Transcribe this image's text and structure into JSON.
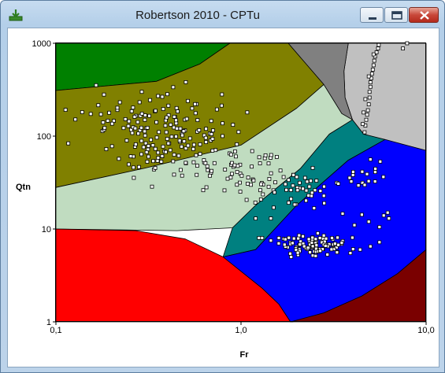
{
  "window": {
    "title": "Robertson 2010 - CPTu",
    "app_icon": "download-icon",
    "controls": {
      "minimize": "minimize-icon",
      "maximize": "maximize-icon",
      "close": "close-icon"
    }
  },
  "chart_data": {
    "type": "scatter",
    "title": "",
    "xlabel": "Fr",
    "ylabel": "Qtn",
    "xscale": "log",
    "yscale": "log",
    "xlim": [
      0.1,
      10
    ],
    "ylim": [
      1,
      1000
    ],
    "xticks": [
      {
        "value": 0.1,
        "label": "0,1"
      },
      {
        "value": 1,
        "label": "1,0"
      },
      {
        "value": 10,
        "label": "10,0"
      }
    ],
    "yticks": [
      {
        "value": 1,
        "label": "1"
      },
      {
        "value": 10,
        "label": "10"
      },
      {
        "value": 100,
        "label": "100"
      },
      {
        "value": 1000,
        "label": "1000"
      }
    ],
    "grid": false,
    "zone_colors": {
      "zone1": "#ff0000",
      "zone2": "#7a0000",
      "zone3": "#0000ff",
      "zone4": "#008080",
      "zone5": "#c0dcc0",
      "zone6": "#808000",
      "zone7": "#008000",
      "zone8": "#808080",
      "zone9": "#c0c0c0",
      "background": "#ffffff"
    },
    "zones": [
      {
        "id": "zone9",
        "points": [
          [
            3.8,
            1000
          ],
          [
            3.6,
            500
          ],
          [
            3.65,
            260
          ],
          [
            4.0,
            150
          ],
          [
            4.6,
            105
          ],
          [
            10,
            70
          ],
          [
            10,
            1000
          ]
        ]
      },
      {
        "id": "zone8",
        "points": [
          [
            1.8,
            1000
          ],
          [
            2.8,
            360
          ],
          [
            3.5,
            175
          ],
          [
            4.0,
            150
          ],
          [
            3.65,
            260
          ],
          [
            3.6,
            500
          ],
          [
            3.8,
            1000
          ]
        ]
      },
      {
        "id": "zone7",
        "points": [
          [
            0.1,
            1000
          ],
          [
            0.87,
            1000
          ],
          [
            0.6,
            600
          ],
          [
            0.35,
            390
          ],
          [
            0.1,
            310
          ]
        ]
      },
      {
        "id": "zone6",
        "points": [
          [
            0.1,
            310
          ],
          [
            0.35,
            390
          ],
          [
            0.6,
            600
          ],
          [
            0.87,
            1000
          ],
          [
            1.8,
            1000
          ],
          [
            2.8,
            360
          ],
          [
            2.0,
            200
          ],
          [
            1.0,
            80
          ],
          [
            0.3,
            45
          ],
          [
            0.1,
            28
          ]
        ]
      },
      {
        "id": "zone5",
        "points": [
          [
            0.1,
            28
          ],
          [
            0.3,
            45
          ],
          [
            1.0,
            80
          ],
          [
            2.0,
            200
          ],
          [
            2.8,
            360
          ],
          [
            3.5,
            175
          ],
          [
            4.0,
            150
          ],
          [
            3.0,
            105
          ],
          [
            2.1,
            45
          ],
          [
            1.2,
            18
          ],
          [
            0.9,
            10.3
          ],
          [
            0.45,
            9.6
          ],
          [
            0.1,
            10
          ]
        ]
      },
      {
        "id": "zone4",
        "points": [
          [
            0.9,
            10.3
          ],
          [
            1.2,
            18
          ],
          [
            2.1,
            45
          ],
          [
            3.0,
            105
          ],
          [
            4.0,
            150
          ],
          [
            4.6,
            105
          ],
          [
            6.0,
            92
          ],
          [
            3.8,
            55
          ],
          [
            2.0,
            18
          ],
          [
            1.2,
            6
          ],
          [
            0.8,
            5
          ]
        ]
      },
      {
        "id": "zone3",
        "points": [
          [
            0.8,
            5
          ],
          [
            1.2,
            6
          ],
          [
            2.0,
            18
          ],
          [
            3.8,
            55
          ],
          [
            6.0,
            92
          ],
          [
            10,
            70
          ],
          [
            10,
            6
          ],
          [
            7.0,
            3.3
          ],
          [
            4.5,
            1.9
          ],
          [
            2.8,
            1.25
          ],
          [
            1.9,
            1
          ],
          [
            1.85,
            1
          ],
          [
            1.6,
            1.55
          ],
          [
            1.3,
            2.3
          ],
          [
            1.0,
            3.5
          ]
        ]
      },
      {
        "id": "zone2",
        "points": [
          [
            1.85,
            1
          ],
          [
            2.8,
            1.25
          ],
          [
            4.5,
            1.9
          ],
          [
            7.0,
            3.3
          ],
          [
            10,
            6
          ],
          [
            10,
            1
          ]
        ]
      },
      {
        "id": "zone1",
        "points": [
          [
            0.1,
            10
          ],
          [
            0.27,
            9.6
          ],
          [
            0.5,
            7.8
          ],
          [
            0.8,
            5
          ],
          [
            1.0,
            3.5
          ],
          [
            1.3,
            2.3
          ],
          [
            1.6,
            1.55
          ],
          [
            1.85,
            1
          ],
          [
            0.1,
            1
          ]
        ]
      }
    ],
    "clusters": [
      {
        "name": "",
        "center": [
          0.34,
          130
        ],
        "spread": [
          0.22,
          0.19
        ],
        "count": 130
      },
      {
        "name": "",
        "center": [
          0.55,
          60
        ],
        "spread": [
          0.2,
          0.14
        ],
        "count": 60
      },
      {
        "name": "",
        "center": [
          1.0,
          40
        ],
        "spread": [
          0.13,
          0.13
        ],
        "count": 35
      },
      {
        "name": "",
        "center": [
          1.7,
          30
        ],
        "spread": [
          0.13,
          0.14
        ],
        "count": 30
      },
      {
        "name": "",
        "center": [
          2.5,
          25
        ],
        "spread": [
          0.12,
          0.12
        ],
        "count": 25
      },
      {
        "name": "",
        "center": [
          4.6,
          40
        ],
        "spread": [
          0.06,
          0.07
        ],
        "count": 14
      },
      {
        "name": "",
        "center": [
          2.4,
          6.5
        ],
        "spread": [
          0.09,
          0.06
        ],
        "count": 90
      }
    ],
    "series": [
      {
        "name": "",
        "points": [
          [
            4.65,
            110
          ],
          [
            4.7,
            130
          ],
          [
            4.75,
            150
          ],
          [
            4.8,
            170
          ],
          [
            4.85,
            190
          ],
          [
            4.9,
            220
          ],
          [
            4.95,
            260
          ],
          [
            4.95,
            300
          ],
          [
            5.0,
            340
          ],
          [
            5.0,
            380
          ],
          [
            5.05,
            420
          ],
          [
            5.1,
            470
          ],
          [
            5.15,
            520
          ],
          [
            5.2,
            580
          ],
          [
            5.25,
            650
          ],
          [
            5.3,
            720
          ],
          [
            5.4,
            800
          ],
          [
            5.5,
            880
          ],
          [
            5.55,
            960
          ],
          [
            7.9,
            1000
          ],
          [
            7.5,
            880
          ],
          [
            4.6,
            180
          ],
          [
            4.55,
            135
          ],
          [
            4.7,
            250
          ],
          [
            4.9,
            440
          ],
          [
            5.2,
            760
          ],
          [
            0.58,
            48
          ],
          [
            0.95,
            30
          ],
          [
            1.5,
            17
          ],
          [
            1.45,
            13
          ],
          [
            1.2,
            13
          ],
          [
            1.25,
            8
          ],
          [
            6.2,
            15
          ],
          [
            6.3,
            13
          ],
          [
            5.6,
            10.5
          ],
          [
            4.9,
            12
          ],
          [
            5.9,
            14
          ],
          [
            4.1,
            11
          ],
          [
            5.6,
            7.2
          ],
          [
            5.0,
            6.5
          ],
          [
            4.4,
            6.0
          ],
          [
            3.9,
            5.5
          ],
          [
            3.3,
            5.6
          ],
          [
            3.1,
            8.0
          ],
          [
            2.6,
            9.0
          ],
          [
            2.8,
            8.5
          ],
          [
            1.6,
            8.0
          ],
          [
            1.45,
            7.5
          ],
          [
            1.3,
            8.0
          ]
        ]
      }
    ]
  }
}
